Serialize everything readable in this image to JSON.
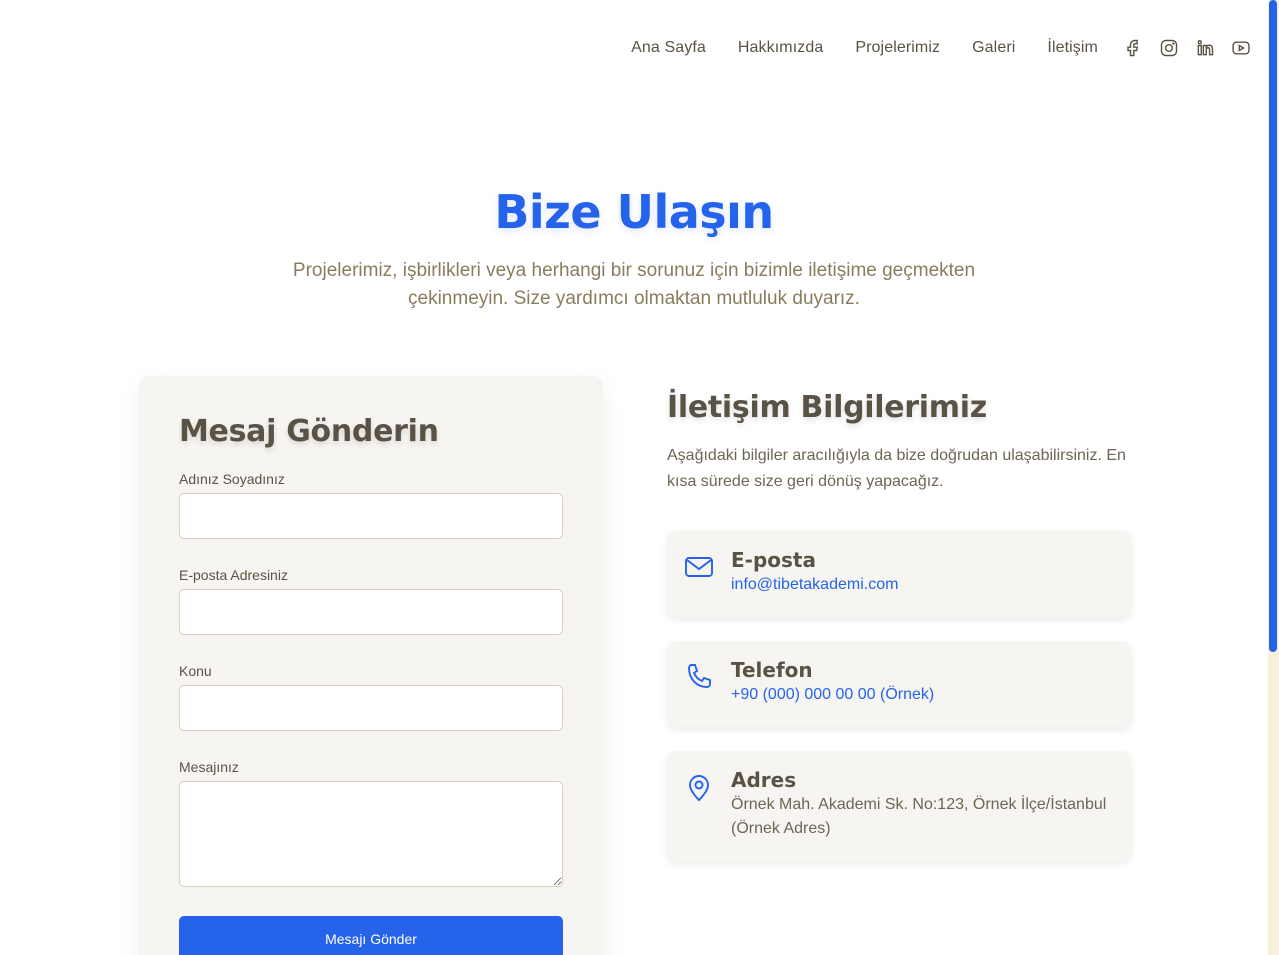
{
  "nav": {
    "links": [
      "Ana Sayfa",
      "Hakkımızda",
      "Projelerimiz",
      "Galeri",
      "İletişim"
    ],
    "social_icons": [
      "facebook-icon",
      "instagram-icon",
      "linkedin-icon",
      "youtube-icon"
    ]
  },
  "hero": {
    "title": "Bize Ulaşın",
    "subtitle": "Projelerimiz, işbirlikleri veya herhangi bir sorunuz için bizimle iletişime geçmekten çekinmeyin. Size yardımcı olmaktan mutluluk duyarız."
  },
  "form": {
    "title": "Mesaj Gönderin",
    "name_label": "Adınız Soyadınız",
    "email_label": "E-posta Adresiniz",
    "subject_label": "Konu",
    "message_label": "Mesajınız",
    "name_value": "",
    "email_value": "",
    "subject_value": "",
    "message_value": "",
    "submit_label": "Mesajı Gönder"
  },
  "info": {
    "title": "İletişim Bilgilerimiz",
    "description": "Aşağıdaki bilgiler aracılığıyla da bize doğrudan ulaşabilirsiniz. En kısa sürede size geri dönüş yapacağız.",
    "email_title": "E-posta",
    "email_value": "info@tibetakademi.com",
    "phone_title": "Telefon",
    "phone_value": "+90 (000) 000 00 00 (Örnek)",
    "address_title": "Adres",
    "address_value": "Örnek Mah. Akademi Sk. No:123, Örnek İlçe/İstanbul (Örnek Adres)"
  },
  "colors": {
    "accent": "#2563eb",
    "text": "#5a5345",
    "muted": "#8a7d5e",
    "card_bg": "#f7f5f1",
    "scrollbar_track": "#f8f0dc"
  }
}
